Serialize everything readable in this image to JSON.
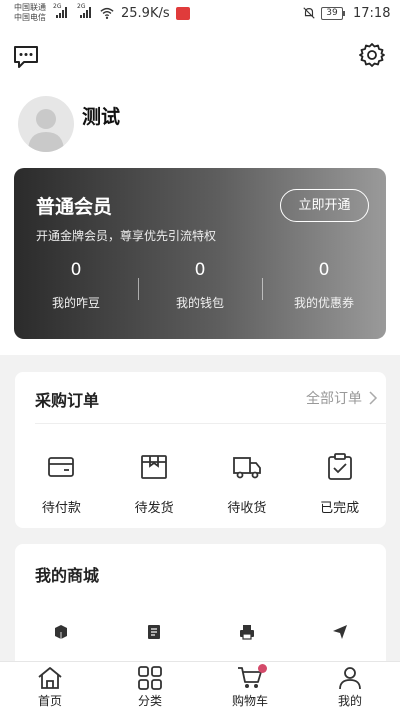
{
  "status_bar": {
    "carrier_1": "中国联通",
    "carrier_2": "中国电信",
    "network_1": "2G",
    "network_2": "2G",
    "speed": "25.9K/s",
    "battery": "39",
    "time": "17:18"
  },
  "header": {
    "username": "测试"
  },
  "member_card": {
    "title": "普通会员",
    "description": "开通金牌会员，尊享优先引流特权",
    "open_button": "立即开通",
    "stats": [
      {
        "value": "0",
        "label": "我的咋豆"
      },
      {
        "value": "0",
        "label": "我的钱包"
      },
      {
        "value": "0",
        "label": "我的优惠券"
      }
    ]
  },
  "orders": {
    "title": "采购订单",
    "all_link": "全部订单",
    "items": [
      {
        "label": "待付款",
        "icon": "wallet-icon"
      },
      {
        "label": "待发货",
        "icon": "package-icon"
      },
      {
        "label": "待收货",
        "icon": "truck-icon"
      },
      {
        "label": "已完成",
        "icon": "clipboard-check-icon"
      }
    ]
  },
  "shop": {
    "title": "我的商城",
    "icons": [
      "cube-icon",
      "document-icon",
      "printer-icon",
      "send-icon"
    ]
  },
  "tabbar": {
    "items": [
      {
        "label": "首页",
        "icon": "home-icon"
      },
      {
        "label": "分类",
        "icon": "grid-icon"
      },
      {
        "label": "购物车",
        "icon": "cart-icon"
      },
      {
        "label": "我的",
        "icon": "user-icon"
      }
    ]
  },
  "colors": {
    "card_gradient_start": "#2b2b2b",
    "card_gradient_end": "#9a9a9a",
    "badge": "#d44a6a",
    "background": "#f2f2f2"
  }
}
